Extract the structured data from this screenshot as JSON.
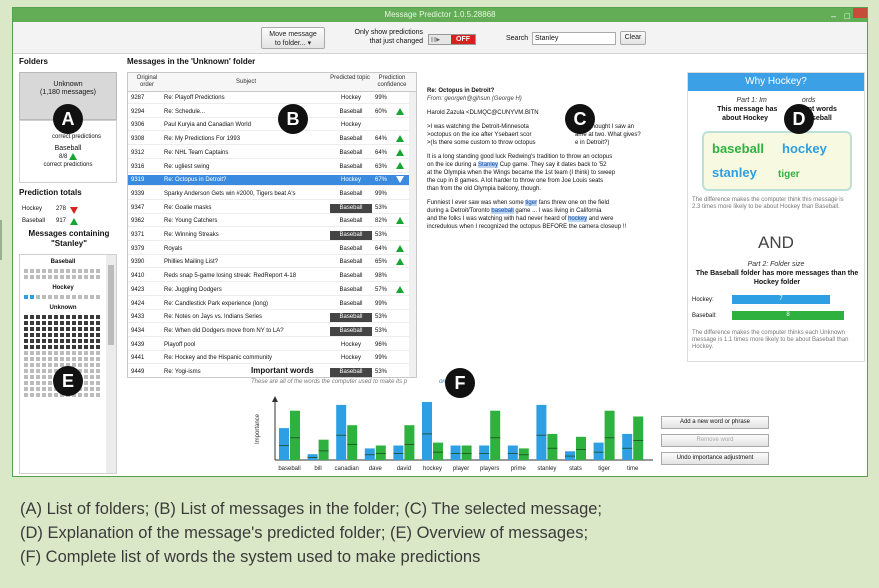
{
  "window": {
    "title": "Message Predictor 1.0.5.28868"
  },
  "toolbar": {
    "move_label": "Move message\nto folder...",
    "show_label": "Only show predictions\nthat just changed",
    "toggle_state": "OFF",
    "search_label": "Search",
    "search_value": "Stanley",
    "clear_label": "Clear"
  },
  "folders": {
    "heading": "Folders",
    "unknown_name": "Unknown",
    "unknown_count": "(1,180 messages)",
    "hockey_label": "correct predictions",
    "baseball_name": "Baseball",
    "baseball_count": "8/8",
    "baseball_label": "correct predictions"
  },
  "prediction_totals": {
    "heading": "Prediction totals",
    "hockey_name": "Hockey",
    "hockey_value": "278",
    "baseball_name": "Baseball",
    "baseball_value": "917"
  },
  "containing": {
    "heading": "Messages containing\n\"Stanley\"",
    "baseball": "Baseball",
    "hockey": "Hockey",
    "unknown": "Unknown"
  },
  "messages": {
    "heading": "Messages in the 'Unknown' folder",
    "columns": [
      "Original order",
      "Subject",
      "Predicted topic",
      "Prediction confidence"
    ],
    "rows": [
      {
        "order": "9287",
        "subject": "Re: Playoff Predictions",
        "topic": "Hockey",
        "conf": "99%",
        "arrow": "",
        "dark": false,
        "sel": false
      },
      {
        "order": "9294",
        "subject": "Re: Schedule...",
        "topic": "Baseball",
        "conf": "60%",
        "arrow": "up",
        "dark": false,
        "sel": false
      },
      {
        "order": "9306",
        "subject": "Paul Kuryia and Canadian World",
        "topic": "Hockey",
        "conf": "",
        "arrow": "",
        "dark": false,
        "sel": false
      },
      {
        "order": "9308",
        "subject": "Re: My Predictions For 1993",
        "topic": "Baseball",
        "conf": "64%",
        "arrow": "up",
        "dark": false,
        "sel": false
      },
      {
        "order": "9312",
        "subject": "Re: NHL Team Captains",
        "topic": "Baseball",
        "conf": "64%",
        "arrow": "up",
        "dark": false,
        "sel": false
      },
      {
        "order": "9316",
        "subject": "Re: ugliest swing",
        "topic": "Baseball",
        "conf": "63%",
        "arrow": "up",
        "dark": false,
        "sel": false
      },
      {
        "order": "9319",
        "subject": "Re: Octopus in Detroit?",
        "topic": "Hockey",
        "conf": "67%",
        "arrow": "down",
        "dark": false,
        "sel": true
      },
      {
        "order": "9339",
        "subject": "Sparky Anderson Gets win #2000, Tigers beat A's",
        "topic": "Baseball",
        "conf": "99%",
        "arrow": "",
        "dark": false,
        "sel": false
      },
      {
        "order": "9347",
        "subject": "Re: Goalie masks",
        "topic": "Baseball",
        "conf": "53%",
        "arrow": "",
        "dark": true,
        "sel": false
      },
      {
        "order": "9362",
        "subject": "Re: Young Catchers",
        "topic": "Baseball",
        "conf": "82%",
        "arrow": "up",
        "dark": false,
        "sel": false
      },
      {
        "order": "9371",
        "subject": "Re: Winning Streaks",
        "topic": "Baseball",
        "conf": "53%",
        "arrow": "",
        "dark": true,
        "sel": false
      },
      {
        "order": "9379",
        "subject": "Royals",
        "topic": "Baseball",
        "conf": "64%",
        "arrow": "up",
        "dark": false,
        "sel": false
      },
      {
        "order": "9390",
        "subject": "Phillies Mailing List?",
        "topic": "Baseball",
        "conf": "65%",
        "arrow": "up",
        "dark": false,
        "sel": false
      },
      {
        "order": "9410",
        "subject": "Reds snap 5-game losing streak: RedReport 4-18",
        "topic": "Baseball",
        "conf": "98%",
        "arrow": "",
        "dark": false,
        "sel": false
      },
      {
        "order": "9423",
        "subject": "Re: Juggling Dodgers",
        "topic": "Baseball",
        "conf": "57%",
        "arrow": "up",
        "dark": false,
        "sel": false
      },
      {
        "order": "9424",
        "subject": "Re: Candlestick Park experience (long)",
        "topic": "Baseball",
        "conf": "99%",
        "arrow": "",
        "dark": false,
        "sel": false
      },
      {
        "order": "9433",
        "subject": "Re: Notes on Jays vs. Indians Series",
        "topic": "Baseball",
        "conf": "53%",
        "arrow": "",
        "dark": true,
        "sel": false
      },
      {
        "order": "9434",
        "subject": "Re: When did Dodgers move from NY to LA?",
        "topic": "Baseball",
        "conf": "53%",
        "arrow": "",
        "dark": true,
        "sel": false
      },
      {
        "order": "9439",
        "subject": "Playoff pool",
        "topic": "Hockey",
        "conf": "96%",
        "arrow": "",
        "dark": false,
        "sel": false
      },
      {
        "order": "9441",
        "subject": "Re: Hockey and the Hispanic community",
        "topic": "Hockey",
        "conf": "99%",
        "arrow": "",
        "dark": false,
        "sel": false
      },
      {
        "order": "9449",
        "subject": "Re: Yogi-isms",
        "topic": "Baseball",
        "conf": "53%",
        "arrow": "",
        "dark": true,
        "sel": false
      }
    ]
  },
  "message": {
    "subject": "Re: Octopus in Detroit?",
    "from": "From: georgeh@gjhsun (George H)",
    "header": "Harold Zazula <DLMQC@CUNYVM.BITN",
    "p1": ">I was watching the Detroit-Minnesota",
    "p1b": "t and thought I saw an",
    "p2": ">octopus on the ice after Ysebaert scor",
    "p2b": "ame at two. What gives?",
    "p3": ">(Is there some custom to throw octopus",
    "p3b": "e in Detroit?)",
    "b1": "It is a long standing good luck Redwing's tradition to throw an octopus",
    "b2a": "on the ice during a ",
    "b2h": "Stanley",
    "b2b": " Cup game. They say it dates back to '52",
    "b3": "at the Olympia when the Wings became the 1st team (I think) to sweep",
    "b4": "the cup in 8 games. A lot harder to throw one from Joe Louis seats",
    "b5": "than from the old Olympia balcony, though.",
    "c1a": "Funniest I ever saw was when some ",
    "c1h": "tiger",
    "c1b": " fans threw one on the field",
    "c2a": "during a Detroit/Toronto ",
    "c2h": "baseball",
    "c2b": " game ... I was living in California",
    "c3a": "and the folks I was watching with had never heard of ",
    "c3h": "hockey",
    "c3b": " and were",
    "c4": "incredulous when I recognized the octopus BEFORE the camera closeup !!"
  },
  "why": {
    "title": "Why Hockey?",
    "part1": "Part 1: Im                  ords",
    "part1_desc": "This message has           rtant words\nabout Hockey                  Baseball",
    "w1": "baseball",
    "w2": "hockey",
    "w3": "stanley",
    "w4": "tiger",
    "diff1": "The difference makes the computer think this message is 2.3 times more likely to be about Hockey than Baseball.",
    "and": "AND",
    "part2": "Part 2: Folder size",
    "part2_desc": "The Baseball folder has more messages than the Hockey folder",
    "hockey_lbl": "Hockey:",
    "hockey_val": "7",
    "baseball_lbl": "Baseball:",
    "baseball_val": "8",
    "diff2": "The difference makes the computer thinks each Unknown message is 1.1 times more likely to be about Baseball than Hockey.",
    "hockey_color": "#2e9fe3",
    "baseball_color": "#2fb140"
  },
  "important": {
    "heading": "Important words",
    "sub": "These are all of the words the computer used to make its p",
    "sub_end": "ore)",
    "ylabel": "Importance",
    "add_btn": "Add a new word or phrase",
    "remove_btn": "Remove word",
    "undo_btn": "Undo importance adjustment"
  },
  "chart_data": {
    "type": "bar",
    "categories": [
      "baseball",
      "bill",
      "canadian",
      "dave",
      "david",
      "hockey",
      "player",
      "players",
      "prime",
      "stanley",
      "stats",
      "tiger",
      "time"
    ],
    "series": [
      {
        "values": [
          0.55,
          0.1,
          0.95,
          0.2,
          0.25,
          1.0,
          0.25,
          0.25,
          0.25,
          0.95,
          0.15,
          0.3,
          0.45
        ]
      },
      {
        "values": [
          0.85,
          0.35,
          0.6,
          0.25,
          0.6,
          0.3,
          0.25,
          0.85,
          0.2,
          0.45,
          0.4,
          0.85,
          0.75
        ]
      }
    ],
    "series_colors": [
      "#2e9fe3",
      "#2fb140"
    ]
  },
  "markers": [
    "A",
    "B",
    "C",
    "D",
    "E",
    "F"
  ],
  "caption": {
    "l1": "(A) List of folders; (B) List of messages in the folder; (C) The selected message;",
    "l2": "(D) Explanation of the message's predicted folder; (E) Overview of messages;",
    "l3": "(F) Complete list of words the system used to make predictions"
  }
}
